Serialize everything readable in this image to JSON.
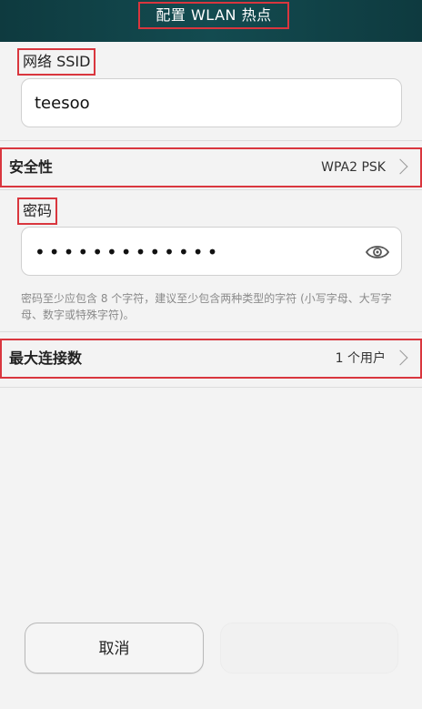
{
  "header": {
    "title": "配置 WLAN 热点"
  },
  "ssid": {
    "label": "网络 SSID",
    "value": "teesoo"
  },
  "security": {
    "label": "安全性",
    "value": "WPA2 PSK",
    "chevron_icon": "chevron-right-icon"
  },
  "password": {
    "label": "密码",
    "masked_value": "•••••••••••••",
    "visibility_icon": "eye-icon",
    "hint": "密码至少应包含 8 个字符，建议至少包含两种类型的字符 (小写字母、大写字母、数字或特殊字符)。"
  },
  "max_connections": {
    "label": "最大连接数",
    "value": "1 个用户",
    "chevron_icon": "chevron-right-icon"
  },
  "buttons": {
    "cancel": "取消",
    "save": ""
  },
  "colors": {
    "header_bg": "#134b50",
    "annotation_border": "#d9363e",
    "page_bg": "#f3f3f3"
  }
}
